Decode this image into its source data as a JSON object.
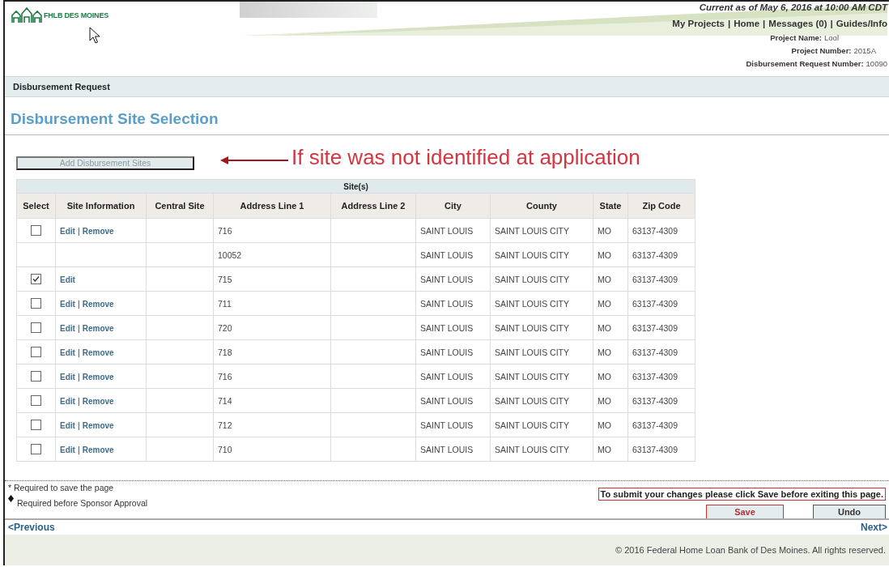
{
  "header": {
    "logo_text": "FHLB DES MOINES",
    "as_of": "Current as of May 6, 2016 at 10:00 AM CDT",
    "nav_links": [
      "My Projects",
      "Home",
      "Messages (0)",
      "Guides/Info"
    ],
    "nav_separator": "|",
    "project_info": [
      {
        "label": "Project Name:",
        "value": "Lool"
      },
      {
        "label": "Project Number:",
        "value": "2015A"
      },
      {
        "label": "Disbursement Request Number:",
        "value": "10090"
      }
    ]
  },
  "section_bar": {
    "title": "Disbursement Request"
  },
  "page_title": "Disbursement Site Selection",
  "add_button": {
    "label": "Add Disbursement Sites",
    "disabled": true
  },
  "annotation": {
    "text": "If site was not identified at application"
  },
  "table": {
    "group_heading": "Site(s)",
    "columns": [
      "Select",
      "Site Information",
      "Central Site",
      "Address Line 1",
      "Address Line 2",
      "City",
      "County",
      "State",
      "Zip Code"
    ],
    "action_separator": "|",
    "rows": [
      {
        "kind": "site",
        "checked": false,
        "actions": [
          "Edit",
          "Remove"
        ],
        "address_line_1": "716",
        "city": "SAINT LOUIS",
        "county": "SAINT LOUIS CITY",
        "state": "MO",
        "zip_code": "63137-4309"
      },
      {
        "kind": "sub",
        "address_line_1": "10052",
        "city": "SAINT LOUIS",
        "county": "SAINT LOUIS CITY",
        "state": "MO",
        "zip_code": "63137-4309"
      },
      {
        "kind": "site",
        "checked": true,
        "actions": [
          "Edit"
        ],
        "address_line_1": "715",
        "city": "SAINT LOUIS",
        "county": "SAINT LOUIS CITY",
        "state": "MO",
        "zip_code": "63137-4309"
      },
      {
        "kind": "site",
        "checked": false,
        "actions": [
          "Edit",
          "Remove"
        ],
        "address_line_1": "711",
        "city": "SAINT LOUIS",
        "county": "SAINT LOUIS CITY",
        "state": "MO",
        "zip_code": "63137-4309"
      },
      {
        "kind": "site",
        "checked": false,
        "actions": [
          "Edit",
          "Remove"
        ],
        "address_line_1": "720",
        "city": "SAINT LOUIS",
        "county": "SAINT LOUIS CITY",
        "state": "MO",
        "zip_code": "63137-4309"
      },
      {
        "kind": "site",
        "checked": false,
        "actions": [
          "Edit",
          "Remove"
        ],
        "address_line_1": "718",
        "city": "SAINT LOUIS",
        "county": "SAINT LOUIS CITY",
        "state": "MO",
        "zip_code": "63137-4309"
      },
      {
        "kind": "site",
        "checked": false,
        "actions": [
          "Edit",
          "Remove"
        ],
        "address_line_1": "716",
        "city": "SAINT LOUIS",
        "county": "SAINT LOUIS CITY",
        "state": "MO",
        "zip_code": "63137-4309"
      },
      {
        "kind": "site",
        "checked": false,
        "actions": [
          "Edit",
          "Remove"
        ],
        "address_line_1": "714",
        "city": "SAINT LOUIS",
        "county": "SAINT LOUIS CITY",
        "state": "MO",
        "zip_code": "63137-4309"
      },
      {
        "kind": "site",
        "checked": false,
        "actions": [
          "Edit",
          "Remove"
        ],
        "address_line_1": "712",
        "city": "SAINT LOUIS",
        "county": "SAINT LOUIS CITY",
        "state": "MO",
        "zip_code": "63137-4309"
      },
      {
        "kind": "site",
        "checked": false,
        "actions": [
          "Edit",
          "Remove"
        ],
        "address_line_1": "710",
        "city": "SAINT LOUIS",
        "county": "SAINT LOUIS CITY",
        "state": "MO",
        "zip_code": "63137-4309"
      }
    ]
  },
  "footer": {
    "notes": [
      {
        "kind": "asterisk",
        "text": "* Required to save the page"
      },
      {
        "kind": "diamond",
        "text": "Required before Sponsor Approval"
      }
    ],
    "save_notice": "To submit your changes please click Save before exiting this page.",
    "buttons": [
      {
        "kind": "save",
        "label": "Save"
      },
      {
        "kind": "undo",
        "label": "Undo"
      }
    ],
    "previous_link": "<Previous",
    "next_link": "Next>",
    "copyright": "© 2016 Federal Home Loan Bank of Des Moines. All rights reserved."
  }
}
